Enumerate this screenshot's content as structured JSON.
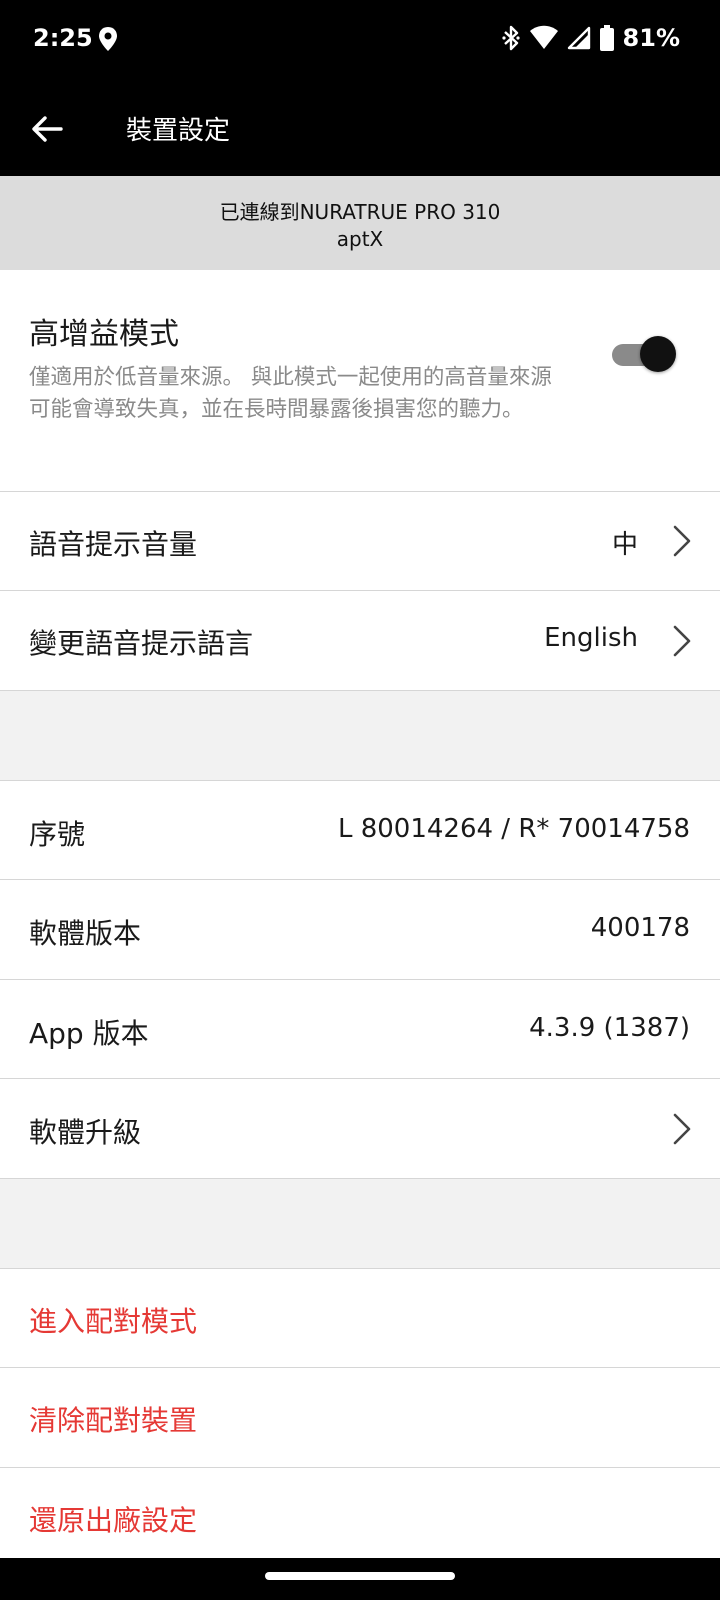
{
  "status_bar": {
    "time": "2:25",
    "battery": "81%",
    "icons": [
      "location-icon",
      "bluetooth-icon",
      "wifi-icon",
      "signal-icon",
      "battery-icon"
    ]
  },
  "app_bar": {
    "title": "裝置設定",
    "back_icon": "arrow-left-icon"
  },
  "connection": {
    "line1": "已連線到NURATRUE PRO 310",
    "line2": "aptX"
  },
  "settings": {
    "high_gain": {
      "title": "高增益模式",
      "description": "僅適用於低音量來源。 與此模式一起使用的高音量來源可能會導致失真，並在長時間暴露後損害您的聽力。",
      "enabled": true
    },
    "voice_prompt_volume": {
      "label": "語音提示音量",
      "value": "中"
    },
    "voice_prompt_language": {
      "label": "變更語音提示語言",
      "value": "English"
    }
  },
  "info": {
    "serial": {
      "label": "序號",
      "value": "L 80014264 / R* 70014758"
    },
    "firmware_version": {
      "label": "軟體版本",
      "value": "400178"
    },
    "app_version": {
      "label": "App 版本",
      "value": "4.3.9 (1387)"
    },
    "firmware_upgrade": {
      "label": "軟體升級"
    }
  },
  "actions": {
    "pairing_mode": "進入配對模式",
    "clear_paired": "清除配對裝置",
    "factory_reset": "還原出廠設定"
  },
  "colors": {
    "accent_red": "#e53935",
    "header_bg": "#000000",
    "banner_bg": "#dcdcdc",
    "toggle_track": "#8a8a8a"
  }
}
